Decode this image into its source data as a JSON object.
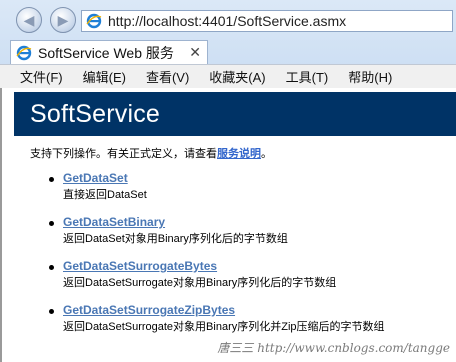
{
  "browser": {
    "address_url": "http://localhost:4401/SoftService.asmx",
    "tab_title": "SoftService Web 服务",
    "tab_close_glyph": "✕",
    "back_glyph": "◀",
    "forward_glyph": "▶",
    "site_icon": "ie-icon",
    "accent_color": "#003366",
    "link_color": "#4a77b4"
  },
  "menu": [
    {
      "label": "文件(F)"
    },
    {
      "label": "编辑(E)"
    },
    {
      "label": "查看(V)"
    },
    {
      "label": "收藏夹(A)"
    },
    {
      "label": "工具(T)"
    },
    {
      "label": "帮助(H)"
    }
  ],
  "page": {
    "title": "SoftService",
    "intro_text": "支持下列操作。有关正式定义，请查看",
    "intro_link": "服务说明",
    "intro_end": "。",
    "operations": [
      {
        "name": "GetDataSet",
        "description": "直接返回DataSet"
      },
      {
        "name": "GetDataSetBinary",
        "description": "返回DataSet对象用Binary序列化后的字节数组"
      },
      {
        "name": "GetDataSetSurrogateBytes",
        "description": "返回DataSetSurrogate对象用Binary序列化后的字节数组"
      },
      {
        "name": "GetDataSetSurrogateZipBytes",
        "description": "返回DataSetSurrogate对象用Binary序列化并Zip压缩后的字节数组"
      }
    ],
    "watermark": "唐三三 http://www.cnblogs.com/tangge"
  }
}
